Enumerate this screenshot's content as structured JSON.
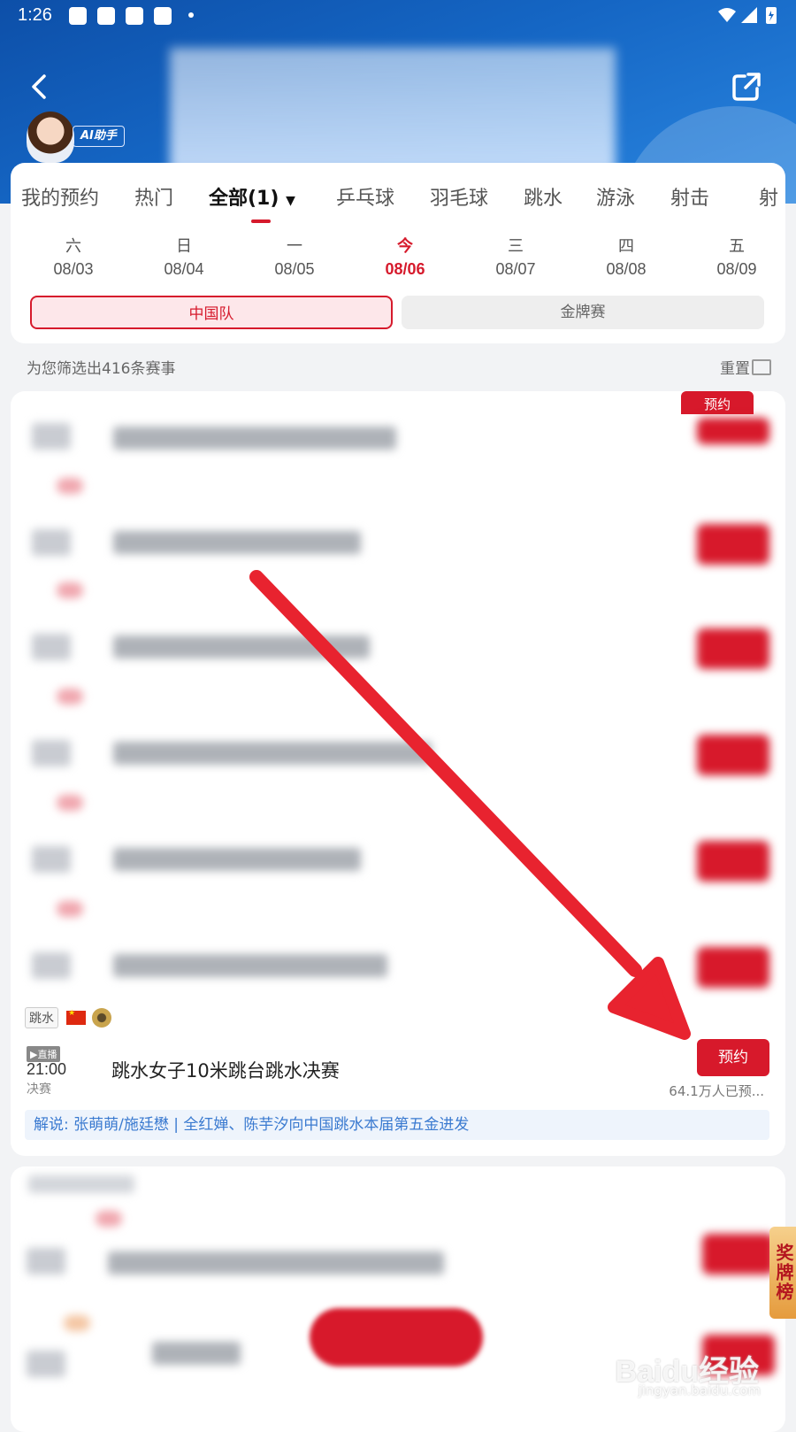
{
  "status_bar": {
    "time": "1:26"
  },
  "header": {
    "ai_label": "AI助手"
  },
  "tabs": [
    {
      "label": "我的预约"
    },
    {
      "label": "热门"
    },
    {
      "label": "全部(1)",
      "active": true
    },
    {
      "label": "乒乓球"
    },
    {
      "label": "羽毛球"
    },
    {
      "label": "跳水"
    },
    {
      "label": "游泳"
    },
    {
      "label": "射击"
    },
    {
      "label": "射"
    }
  ],
  "dates": [
    {
      "weekday": "六",
      "date": "08/03"
    },
    {
      "weekday": "日",
      "date": "08/04"
    },
    {
      "weekday": "一",
      "date": "08/05"
    },
    {
      "weekday": "今",
      "date": "08/06",
      "today": true
    },
    {
      "weekday": "三",
      "date": "08/07"
    },
    {
      "weekday": "四",
      "date": "08/08"
    },
    {
      "weekday": "五",
      "date": "08/09"
    }
  ],
  "filters": {
    "china_team": "中国队",
    "gold_medal": "金牌赛"
  },
  "results": {
    "count_text": "为您筛选出416条赛事",
    "reset_label": "重置"
  },
  "event": {
    "sport": "跳水",
    "live_label": "▶直播",
    "time": "21:00",
    "stage": "决赛",
    "title": "跳水女子10米跳台跳水决赛",
    "reserve_label": "预约",
    "reserved_count": "64.1万人已预...",
    "commentary": "解说: 张萌萌/施廷懋 | 全红婵、陈芋汐向中国跳水本届第五金进发"
  },
  "top_reserve_label": "预约",
  "medal_tab": "奖牌榜",
  "watermark": {
    "main": "Baidu经验",
    "sub": "jingyan.baidu.com"
  },
  "colors": {
    "accent_red": "#d61a2c",
    "header_blue": "#1566c4",
    "link_blue": "#3a7ad0"
  }
}
